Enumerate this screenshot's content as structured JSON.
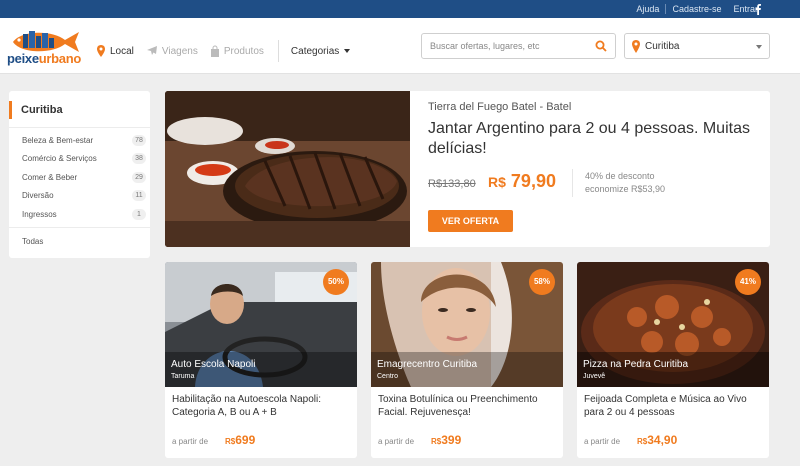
{
  "topbar": {
    "help": "Ajuda",
    "signup": "Cadastre-se",
    "login": "Entrar",
    "social_icon": "facebook-icon"
  },
  "header": {
    "logo": {
      "part1": "peixe",
      "part2": "urbano"
    },
    "nav": [
      {
        "label": "Local",
        "icon": "map-pin-icon"
      },
      {
        "label": "Viagens",
        "icon": "plane-icon"
      },
      {
        "label": "Produtos",
        "icon": "bag-icon"
      }
    ],
    "categories_label": "Categorias",
    "search": {
      "placeholder": "Buscar ofertas, lugares, etc",
      "icon": "search-icon"
    },
    "city": {
      "value": "Curitiba"
    },
    "colors": {
      "brand_blue": "#1f4e86",
      "accent_orange": "#f07b1f"
    }
  },
  "sidebar": {
    "title": "Curitiba",
    "items": [
      {
        "label": "Beleza & Bem-estar",
        "count": "78"
      },
      {
        "label": "Comércio & Serviços",
        "count": "38"
      },
      {
        "label": "Comer & Beber",
        "count": "29"
      },
      {
        "label": "Diversão",
        "count": "11"
      },
      {
        "label": "Ingressos",
        "count": "1"
      }
    ],
    "all_label": "Todas"
  },
  "featured": {
    "location": "Tierra del Fuego Batel - Batel",
    "title": "Jantar Argentino para 2 ou 4 pessoas. Muitas delícias!",
    "old_price": "R$133,80",
    "currency": "R$",
    "new_price": "79,90",
    "discount": "40% de desconto",
    "savings": "economize R$53,90",
    "cta": "VER OFERTA"
  },
  "deals": [
    {
      "badge": "50%",
      "name": "Auto Escola Napoli",
      "area": "Taruma",
      "desc": "Habilitação na Autoescola Napoli: Categoria A, B ou A + B",
      "from_label": "a partir de",
      "currency": "R$",
      "price": "699"
    },
    {
      "badge": "58%",
      "name": "Emagrecentro Curitiba",
      "area": "Centro",
      "desc": "Toxina Botulínica ou Preenchimento Facial. Rejuvenesça!",
      "from_label": "a partir de",
      "currency": "R$",
      "price": "399"
    },
    {
      "badge": "41%",
      "name": "Pizza na Pedra Curitiba",
      "area": "Juvevê",
      "desc": "Feijoada Completa e Música ao Vivo para 2 ou 4 pessoas",
      "from_label": "a partir de",
      "currency": "R$",
      "price": "34,90"
    }
  ]
}
